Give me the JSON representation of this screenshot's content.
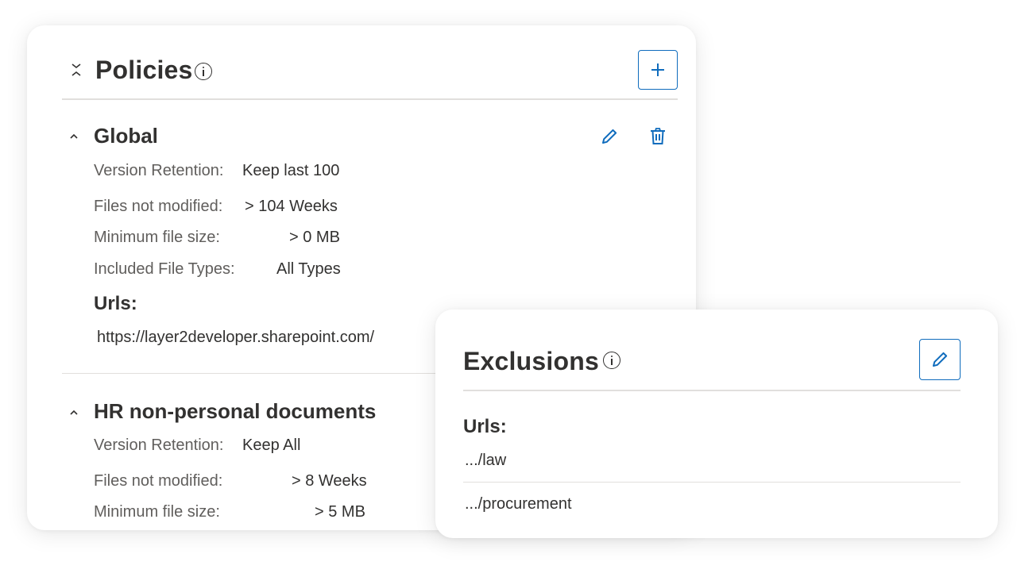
{
  "policies": {
    "title": "Policies",
    "colors": {
      "accent": "#0f6cbd",
      "text": "#323130",
      "label": "#605e5c",
      "divider": "#e1dfdd"
    },
    "icons": {
      "collapse_all": "collapse-all-icon",
      "info": "info-icon",
      "add": "plus-icon"
    },
    "items": [
      {
        "name": "Global",
        "rows": [
          {
            "label": "Version Retention:",
            "value": "Keep last 100"
          },
          {
            "label": "Files not modified:",
            "value": "> 104 Weeks"
          },
          {
            "label": "Minimum file size:",
            "value": "> 0 MB"
          },
          {
            "label": "Included File Types:",
            "value": "All Types"
          }
        ],
        "urls_heading": "Urls:",
        "urls": [
          "https://layer2developer.sharepoint.com/"
        ],
        "icons": {
          "expand": "chevron-up-icon",
          "edit": "pencil-icon",
          "delete": "trash-icon"
        }
      },
      {
        "name": "HR non-personal documents",
        "rows": [
          {
            "label": "Version Retention:",
            "value": "Keep All"
          },
          {
            "label": "Files not modified:",
            "value": "> 8 Weeks"
          },
          {
            "label": "Minimum file size:",
            "value": "> 5 MB"
          }
        ],
        "icons": {
          "expand": "chevron-up-icon"
        }
      }
    ]
  },
  "exclusions": {
    "title": "Exclusions",
    "urls_heading": "Urls:",
    "urls": [
      ".../law",
      ".../procurement"
    ],
    "icons": {
      "info": "info-icon",
      "edit": "pencil-icon"
    }
  }
}
